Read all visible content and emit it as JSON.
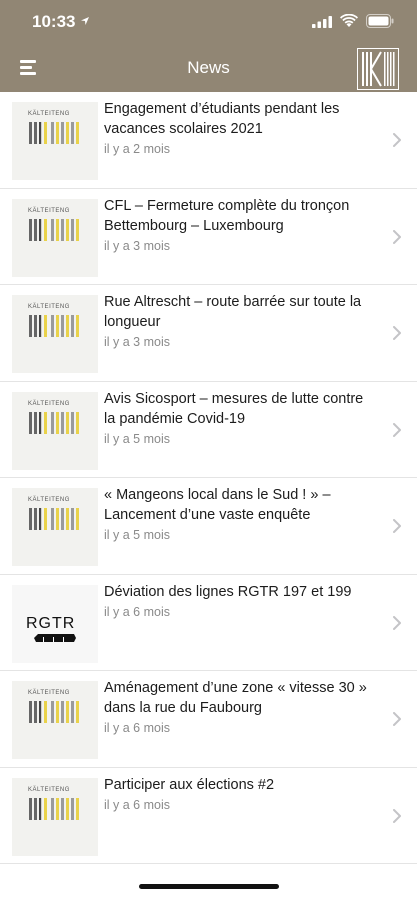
{
  "status_bar": {
    "time": "10:33"
  },
  "nav": {
    "title": "News"
  },
  "items": [
    {
      "title": "Engagement d’étudiants pendant les vacances scolaires 2021",
      "date": "il y a 2 mois",
      "thumb": "logo",
      "logo_text": "KÄLTEITENG"
    },
    {
      "title": "CFL – Fermeture complète du tronçon Bettembourg – Luxembourg",
      "date": "il y a 3 mois",
      "thumb": "logo",
      "logo_text": "KÄLTEITENG"
    },
    {
      "title": "Rue Altrescht – route barrée sur toute la longueur",
      "date": "il y a 3 mois",
      "thumb": "logo",
      "logo_text": "KÄLTEITENG"
    },
    {
      "title": "Avis Sicosport – mesures de lutte contre la pandémie Covid-19",
      "date": "il y a 5 mois",
      "thumb": "logo",
      "logo_text": "KÄLTEITENG"
    },
    {
      "title": "« Mangeons local dans le Sud ! » – Lancement d’une vaste enquête",
      "date": "il y a 5 mois",
      "thumb": "logo",
      "logo_text": "KÄLTEITENG"
    },
    {
      "title": "Déviation des lignes RGTR 197 et 199",
      "date": "il y a 6 mois",
      "thumb": "rgtr",
      "logo_text": "RGTR"
    },
    {
      "title": "Aménagement d’une zone « vitesse 30 » dans la rue du Faubourg",
      "date": "il y a 6 mois",
      "thumb": "logo",
      "logo_text": "KÄLTEITENG"
    },
    {
      "title": "Participer aux élections #2",
      "date": "il y a 6 mois",
      "thumb": "logo",
      "logo_text": "KÄLTEITENG"
    }
  ],
  "colors": {
    "header": "#918674",
    "logo_yellow": "#e9d24a",
    "logo_gray": "#9a9a9a"
  }
}
